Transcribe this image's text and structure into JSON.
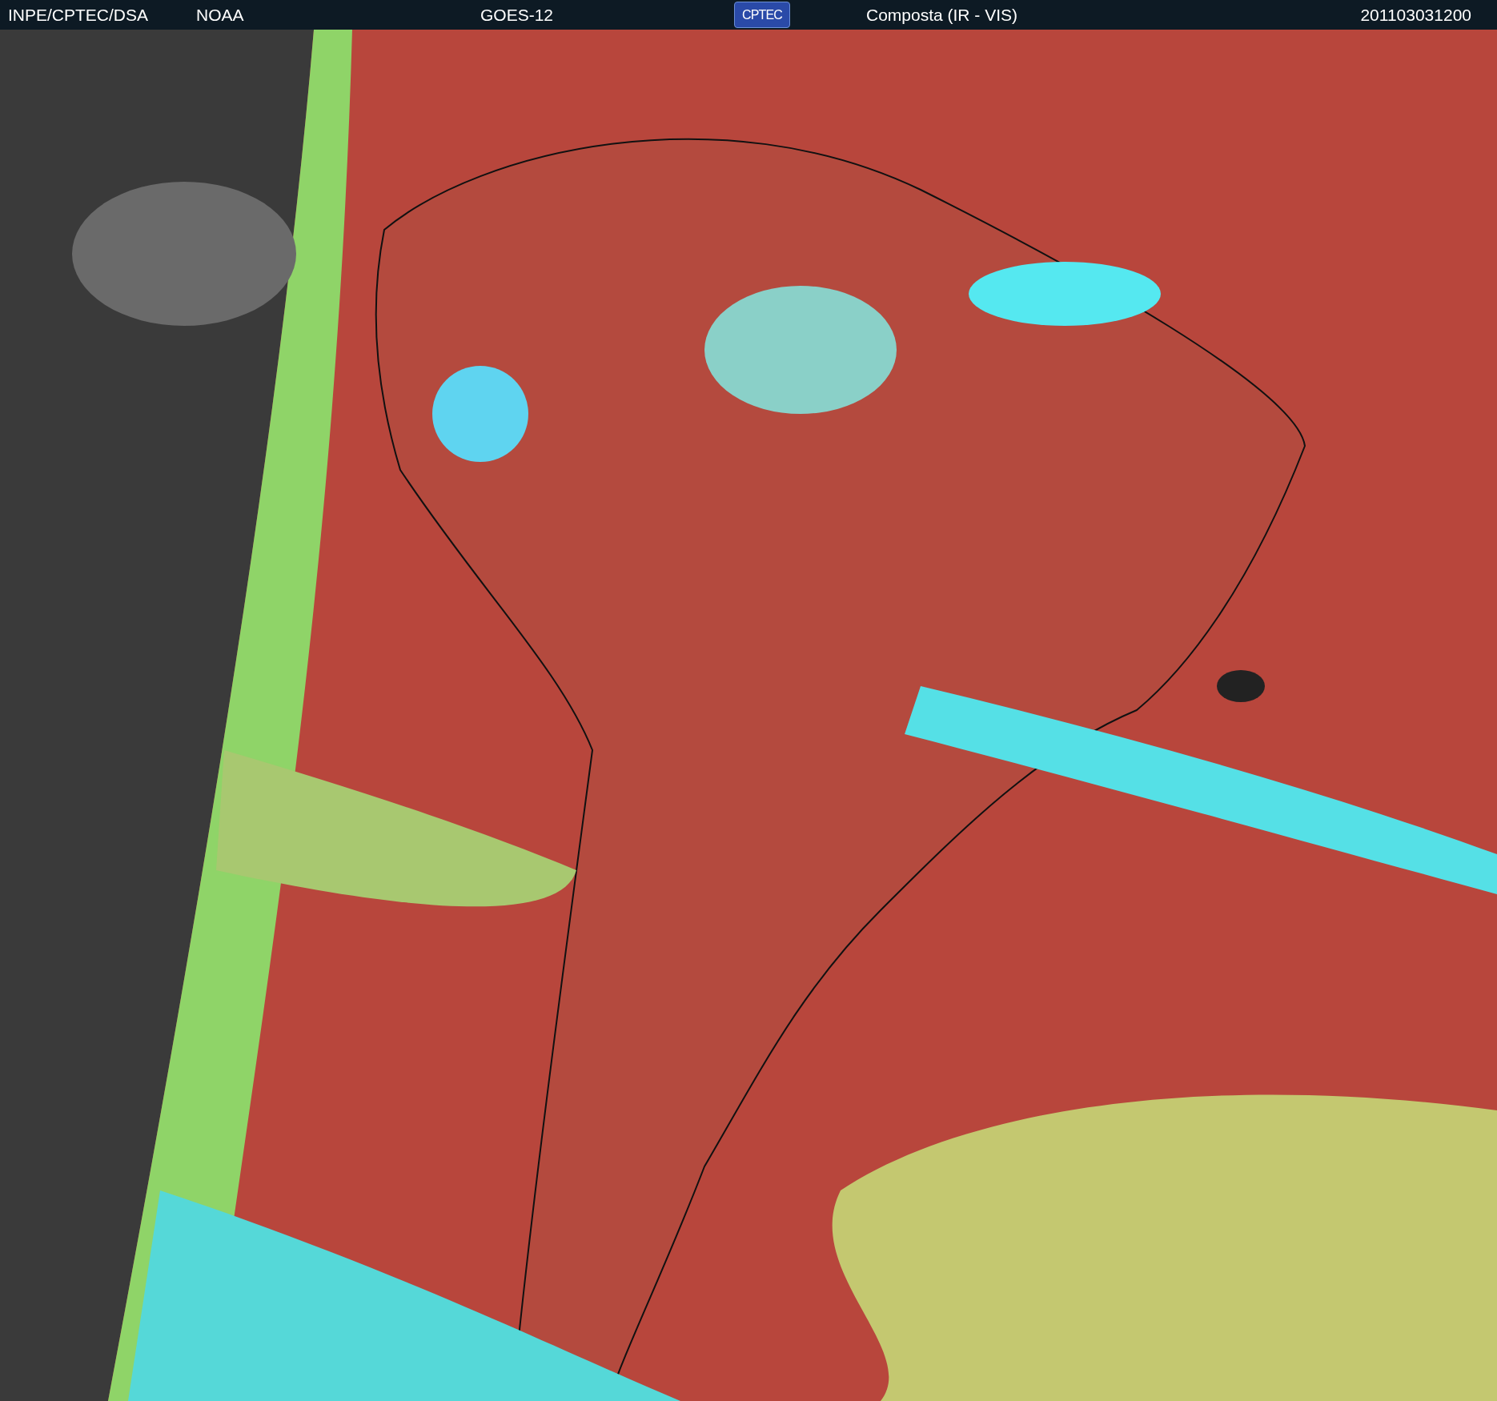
{
  "header": {
    "source": "INPE/CPTEC/DSA",
    "agency": "NOAA",
    "satellite": "GOES-12",
    "logo": "CPTEC",
    "product": "Composta (IR - VIS)",
    "timestamp": "201103031200"
  }
}
